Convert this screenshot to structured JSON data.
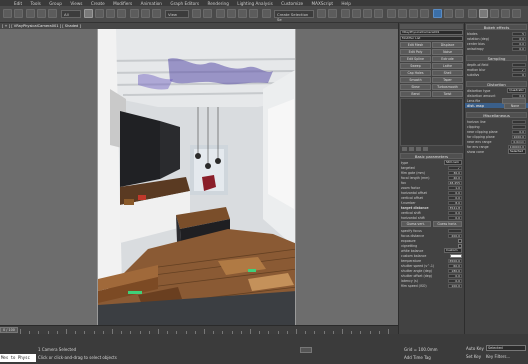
{
  "menu": [
    "Edit",
    "Tools",
    "Group",
    "Views",
    "Create",
    "Modifiers",
    "Animation",
    "Graph Editors",
    "Rendering",
    "Lighting Analysis",
    "Customize",
    "MAXScript",
    "Help"
  ],
  "toolbar": {
    "selection_filter": "All",
    "view_dropdown": "View",
    "named_selection": "Create Selection Se"
  },
  "viewport": {
    "label": "[ + ] [ VRayPhysicalCamera001 ] [ Shaded ]"
  },
  "command_panel": {
    "object_name": "VRayPhysicalCamera001",
    "modifier_list": "Modifier List",
    "modifier_buttons": [
      [
        "Edit Mesh",
        "Displace"
      ],
      [
        "Edit Poly",
        "Noise"
      ],
      [
        "Edit Spline",
        "Extrude"
      ],
      [
        "Sweep",
        "Lathe"
      ],
      [
        "Cap Holes",
        "Shell"
      ],
      [
        "Smooth",
        "Taper"
      ],
      [
        "Skew",
        "Turbosmooth"
      ],
      [
        "Bend",
        "Twist"
      ]
    ],
    "rollout": "Basic parameters",
    "type_label": "type",
    "type_value": "Still cam",
    "params": [
      {
        "label": "targeted",
        "value": "✓"
      },
      {
        "label": "film gate (mm)",
        "value": "36.0"
      },
      {
        "label": "focal length (mm)",
        "value": "40.0"
      },
      {
        "label": "fov",
        "value": "48.455"
      },
      {
        "label": "zoom factor",
        "value": "1.0"
      },
      {
        "label": "horizontal offset",
        "value": "0.0"
      },
      {
        "label": "vertical offset",
        "value": "0.0"
      },
      {
        "label": "f-number",
        "value": "8.0"
      }
    ],
    "target_distance_label": "target distance",
    "target_distance": "3541.8",
    "shift_params": [
      {
        "label": "vertical shift",
        "value": "0.0"
      },
      {
        "label": "horizontal shift",
        "value": "0.0"
      }
    ],
    "guess_vert": "Guess vert.",
    "guess_horiz": "Guess horiz.",
    "focus_params": [
      {
        "label": "specify focus",
        "value": ""
      },
      {
        "label": "focus distance",
        "value": "200.0"
      }
    ],
    "exposure_label": "exposure",
    "vignetting_label": "vignetting",
    "white_balance_label": "white balance",
    "white_balance_value": "Custom",
    "custom_balance_label": "custom balance",
    "temperature_label": "temperature",
    "temperature_value": "6500.0",
    "bottom_params": [
      {
        "label": "shutter speed (s^-1)",
        "value": "60.0"
      },
      {
        "label": "shutter angle (deg)",
        "value": "180.0"
      },
      {
        "label": "shutter offset (deg)",
        "value": "0.0"
      },
      {
        "label": "latency (s)",
        "value": "0.0"
      },
      {
        "label": "film speed (ISO)",
        "value": "100.0"
      }
    ]
  },
  "right_panel": {
    "bokeh_title": "Bokeh effects",
    "bokeh_params": [
      {
        "label": "blades",
        "value": "5"
      },
      {
        "label": "rotation (deg)",
        "value": "0.0"
      },
      {
        "label": "center bias",
        "value": "0.0"
      },
      {
        "label": "anisotropy",
        "value": "0.0"
      }
    ],
    "sampling_title": "Sampling",
    "sampling_params": [
      {
        "label": "depth-of-field",
        "value": ""
      },
      {
        "label": "motion blur",
        "value": "✓"
      },
      {
        "label": "subdivs",
        "value": "6"
      }
    ],
    "distortion_title": "Distortion",
    "distortion_type_label": "distortion type",
    "distortion_type_value": "Quadratic",
    "distortion_amount_label": "distortion amount",
    "distortion_amount_value": "0.0",
    "lens_file": "Lens file",
    "dist_map": "dist. map",
    "none": "None",
    "misc_title": "Miscellaneous",
    "misc_params": [
      {
        "label": "horizon line",
        "value": ""
      },
      {
        "label": "clipping",
        "value": ""
      },
      {
        "label": "near clipping plane",
        "value": "0.0"
      },
      {
        "label": "far clipping plane",
        "value": "1000.0"
      },
      {
        "label": "near env range",
        "value": "0.0mm"
      },
      {
        "label": "far env range",
        "value": "100000.0"
      }
    ],
    "show_cone_label": "show cone",
    "show_cone_value": "Selected"
  },
  "timeline": {
    "frame_label": "0 / 100"
  },
  "status": {
    "selection": "1 Camera Selected",
    "prompt": "Click or click-and-drag to select objects",
    "script_line": "Mes to Physc",
    "grid": "Grid = 100.0mm",
    "add_time_tag": "Add Time Tag",
    "auto_key": "Auto Key",
    "set_key": "Set Key",
    "selected": "Selected",
    "key_filters": "Key Filters..."
  }
}
